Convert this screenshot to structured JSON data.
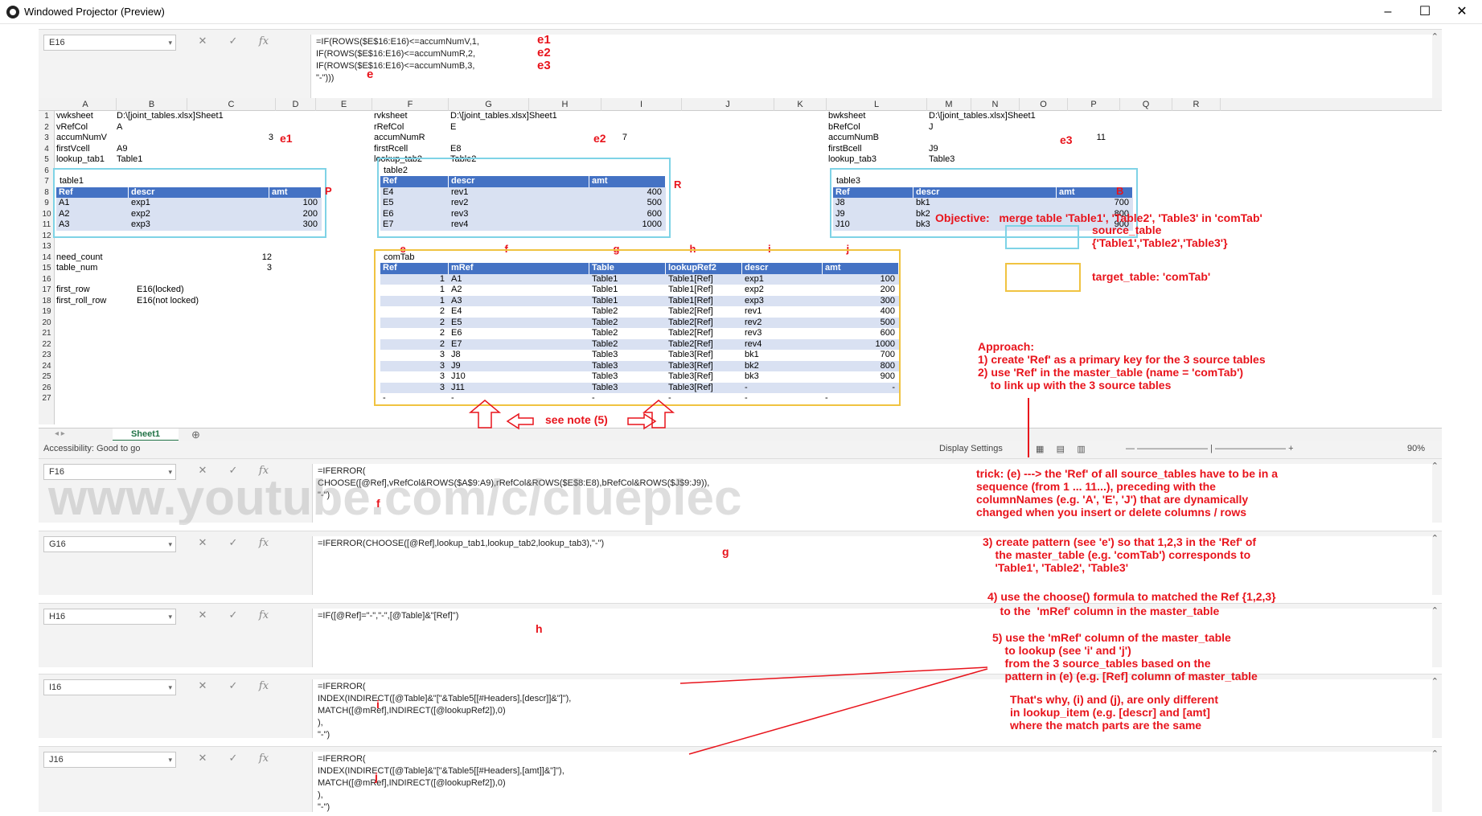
{
  "window": {
    "title": "Windowed Projector (Preview)"
  },
  "top_formula": {
    "cell": "E16",
    "text": "=IF(ROWS($E$16:E16)<=accumNumV,1,\nIF(ROWS($E$16:E16)<=accumNumR,2,\nIF(ROWS($E$16:E16)<=accumNumB,3,\n\"-\")))",
    "notes": [
      "e1",
      "e2",
      "e3",
      "e"
    ]
  },
  "columns": [
    "A",
    "B",
    "C",
    "D",
    "E",
    "F",
    "G",
    "H",
    "I",
    "J",
    "K",
    "L",
    "M",
    "N",
    "O",
    "P",
    "Q",
    "R"
  ],
  "rows": [
    "1",
    "2",
    "3",
    "4",
    "5",
    "6",
    "7",
    "8",
    "9",
    "10",
    "11",
    "12",
    "13",
    "14",
    "15",
    "16",
    "17",
    "18",
    "19",
    "20",
    "21",
    "22",
    "23",
    "24",
    "25",
    "26",
    "27"
  ],
  "block_v": {
    "labels": [
      "vwksheet",
      "vRefCol",
      "accumNumV",
      "firstVcell",
      "lookup_tab1"
    ],
    "values": [
      "D:\\[joint_tables.xlsx]Sheet1",
      "A",
      "3",
      "A9",
      "Table1"
    ],
    "note": "e1"
  },
  "block_r": {
    "labels": [
      "rvksheet",
      "rRefCol",
      "accumNumR",
      "firstRcell",
      "lookup_tab2"
    ],
    "values": [
      "D:\\[joint_tables.xlsx]Sheet1",
      "E",
      "7",
      "E8",
      "Table2"
    ],
    "note": "e2"
  },
  "block_b": {
    "labels": [
      "bwksheet",
      "bRefCol",
      "accumNumB",
      "firstBcell",
      "lookup_tab3"
    ],
    "values": [
      "D:\\[joint_tables.xlsx]Sheet1",
      "J",
      "11",
      "J9",
      "Table3"
    ],
    "note": "e3"
  },
  "table1": {
    "name": "table1",
    "headers": [
      "Ref",
      "descr",
      "amt"
    ],
    "rows": [
      [
        "A1",
        "exp1",
        "100"
      ],
      [
        "A2",
        "exp2",
        "200"
      ],
      [
        "A3",
        "exp3",
        "300"
      ]
    ],
    "tag": "P"
  },
  "table2": {
    "name": "table2",
    "headers": [
      "Ref",
      "descr",
      "amt"
    ],
    "rows": [
      [
        "E4",
        "rev1",
        "400"
      ],
      [
        "E5",
        "rev2",
        "500"
      ],
      [
        "E6",
        "rev3",
        "600"
      ],
      [
        "E7",
        "rev4",
        "1000"
      ]
    ],
    "tag": "R"
  },
  "table3": {
    "name": "table3",
    "headers": [
      "Ref",
      "descr",
      "amt"
    ],
    "rows": [
      [
        "J8",
        "bk1",
        "700"
      ],
      [
        "J9",
        "bk2",
        "800"
      ],
      [
        "J10",
        "bk3",
        "900"
      ]
    ],
    "tag": "B"
  },
  "misc": {
    "need_count": "need_count",
    "need_count_val": "12",
    "table_num": "table_num",
    "table_num_val": "3",
    "first_row": "first_row",
    "first_row_val": "E16(locked)",
    "first_roll_row": "first_roll_row",
    "first_roll_row_val": "E16(not locked)"
  },
  "comtab": {
    "name": "comTab",
    "headers": [
      "Ref",
      "mRef",
      "Table",
      "lookupRef2",
      "descr",
      "amt"
    ],
    "col_letters": [
      "e",
      "f",
      "g",
      "h",
      "i",
      "j"
    ],
    "rows": [
      [
        "1",
        "A1",
        "Table1",
        "Table1[Ref]",
        "exp1",
        "100"
      ],
      [
        "1",
        "A2",
        "Table1",
        "Table1[Ref]",
        "exp2",
        "200"
      ],
      [
        "1",
        "A3",
        "Table1",
        "Table1[Ref]",
        "exp3",
        "300"
      ],
      [
        "2",
        "E4",
        "Table2",
        "Table2[Ref]",
        "rev1",
        "400"
      ],
      [
        "2",
        "E5",
        "Table2",
        "Table2[Ref]",
        "rev2",
        "500"
      ],
      [
        "2",
        "E6",
        "Table2",
        "Table2[Ref]",
        "rev3",
        "600"
      ],
      [
        "2",
        "E7",
        "Table2",
        "Table2[Ref]",
        "rev4",
        "1000"
      ],
      [
        "3",
        "J8",
        "Table3",
        "Table3[Ref]",
        "bk1",
        "700"
      ],
      [
        "3",
        "J9",
        "Table3",
        "Table3[Ref]",
        "bk2",
        "800"
      ],
      [
        "3",
        "J10",
        "Table3",
        "Table3[Ref]",
        "bk3",
        "900"
      ],
      [
        "3",
        "J11",
        "Table3",
        "Table3[Ref]",
        "-",
        "-"
      ],
      [
        "-",
        "-",
        "-",
        "-",
        "-",
        "-"
      ]
    ]
  },
  "note5": "see note (5)",
  "objective": "Objective:   merge table 'Table1', 'Table2', 'Table3' in 'comTab'",
  "legend_source": "source_table\n{'Table1','Table2','Table3'}",
  "legend_target": "target_table: 'comTab'",
  "approach": "Approach:\n1) create 'Ref' as a primary key for the 3 source tables\n2) use 'Ref' in the master_table (name = 'comTab')\n    to link up with the 3 source tables",
  "trick": "trick: (e) ---> the 'Ref' of all source_tables have to be in a\nsequence (from 1 ... 11...), preceding with the\ncolumnNames (e.g. 'A', 'E', 'J') that are dynamically\nchanged when you insert or delete columns / rows",
  "step3": "3) create pattern (see 'e') so that 1,2,3 in the 'Ref' of\n    the master_table (e.g. 'comTab') corresponds to\n    'Table1', 'Table2', 'Table3'",
  "step4": "4) use the choose() formula to matched the Ref {1,2,3}\n    to the  'mRef' column in the master_table",
  "step5": "5) use the 'mRef' column of the master_table\n    to lookup (see 'i' and 'j')\n    from the 3 source_tables based on the\n    pattern in (e) (e.g. [Ref] column of master_table",
  "why": "That's why, (i) and (j), are only different\nin lookup_item (e.g. [descr] and [amt]\nwhere the match parts are the same",
  "sheet_tab": "Sheet1",
  "status": {
    "accessibility": "Accessibility: Good to go",
    "display": "Display Settings",
    "zoom": "90%"
  },
  "formulas": [
    {
      "cell": "F16",
      "text": "=IFERROR(\nCHOOSE([@Ref],vRefCol&ROWS($A$9:A9),rRefCol&ROWS($E$8:E8),bRefCol&ROWS($J$9:J9)),\n\"-\")",
      "tag": "f"
    },
    {
      "cell": "G16",
      "text": "=IFERROR(CHOOSE([@Ref],lookup_tab1,lookup_tab2,lookup_tab3),\"-\")",
      "tag": "g"
    },
    {
      "cell": "H16",
      "text": "=IF([@Ref]=\"-\",\"-\",[@Table]&\"[Ref]\")",
      "tag": "h"
    },
    {
      "cell": "I16",
      "text": "=IFERROR(\nINDEX(INDIRECT([@Table]&\"[\"&Table5[[#Headers],[descr]]&\"]\"),\nMATCH([@mRef],INDIRECT([@lookupRef2]),0)\n),\n\"-\")",
      "tag": "i"
    },
    {
      "cell": "J16",
      "text": "=IFERROR(\nINDEX(INDIRECT([@Table]&\"[\"&Table5[[#Headers],[amt]]&\"]\"),\nMATCH([@mRef],INDIRECT([@lookupRef2]),0)\n),\n\"-\")",
      "tag": "j"
    }
  ],
  "watermark": "www.youtube.com/c/clueplec"
}
